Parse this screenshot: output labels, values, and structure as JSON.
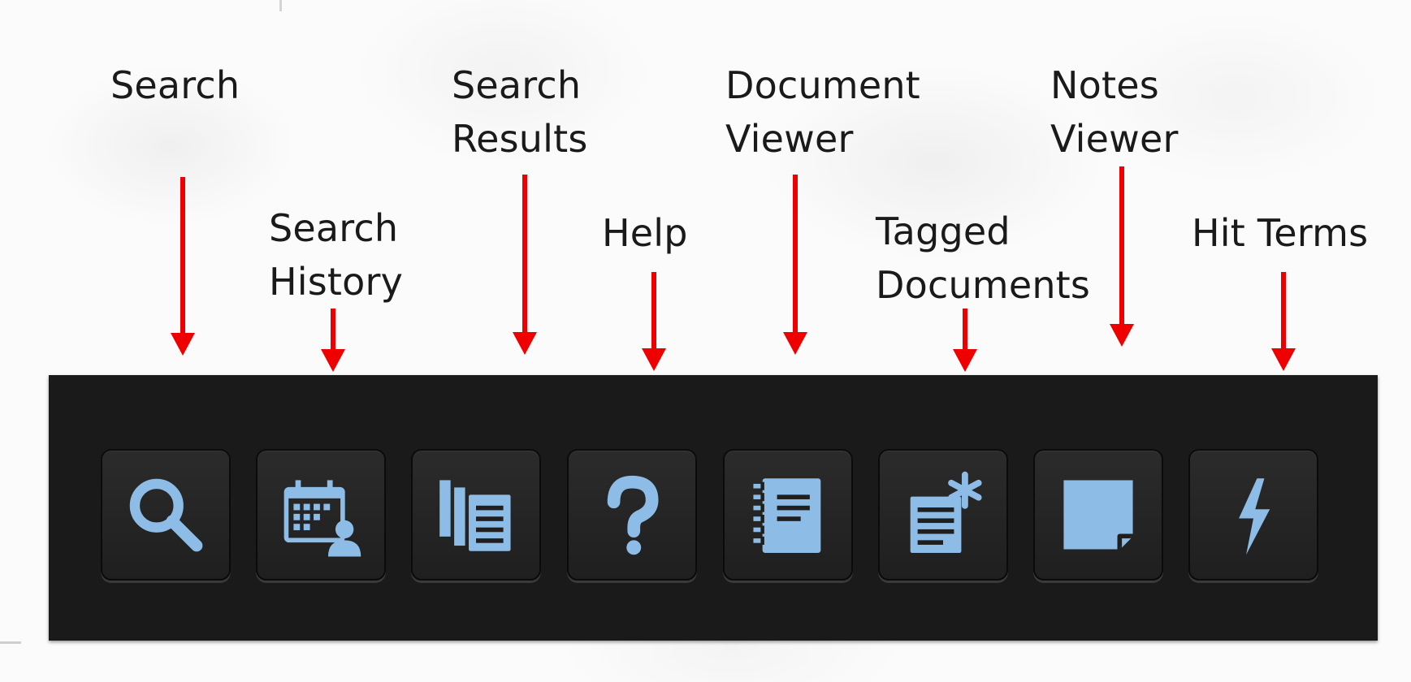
{
  "toolbar": {
    "buttons": [
      {
        "label": "Search",
        "icon": "search-icon"
      },
      {
        "label": "Search\nHistory",
        "icon": "calendar-user-icon"
      },
      {
        "label": "Search\nResults",
        "icon": "stacked-documents-icon"
      },
      {
        "label": "Help",
        "icon": "question-mark-icon"
      },
      {
        "label": "Document\nViewer",
        "icon": "notebook-icon"
      },
      {
        "label": "Tagged\nDocuments",
        "icon": "tagged-document-icon"
      },
      {
        "label": "Notes\nViewer",
        "icon": "sticky-note-icon"
      },
      {
        "label": "Hit Terms",
        "icon": "lightning-icon"
      }
    ]
  },
  "colors": {
    "toolbar_background": "#1a1a1a",
    "button_background": "#262626",
    "icon_color": "#8dbde6",
    "arrow_color": "#ee0000",
    "label_color": "#1a1a1a"
  }
}
